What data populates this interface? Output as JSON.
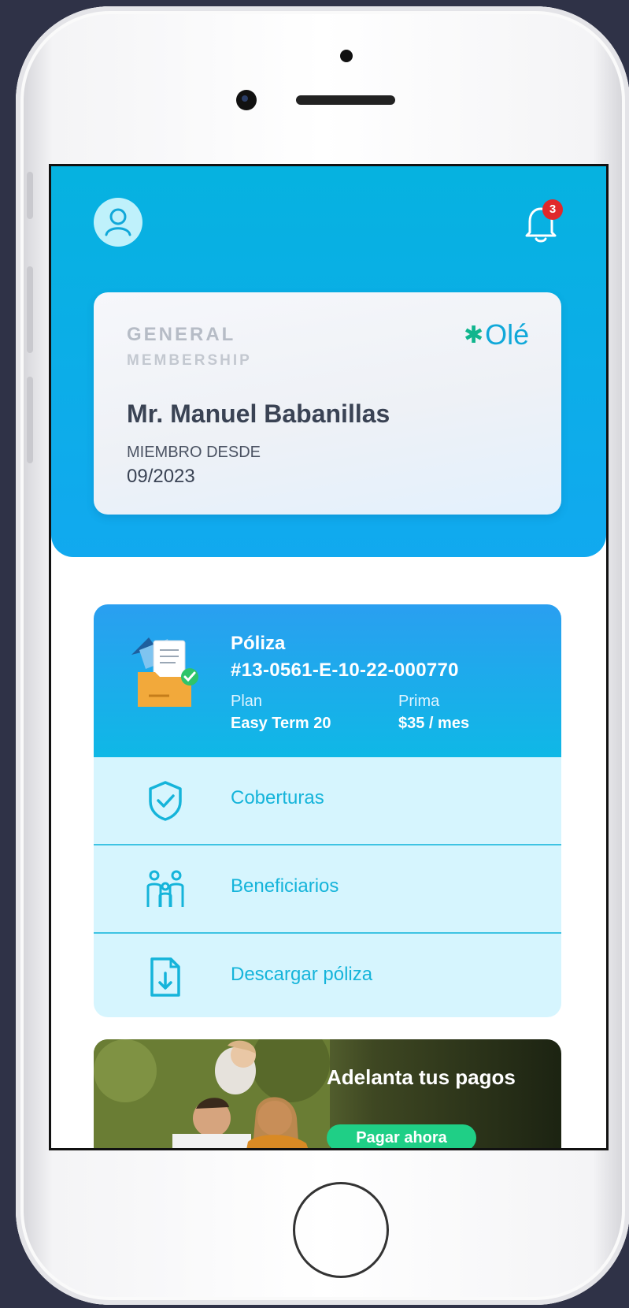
{
  "header": {
    "notification_count": "3"
  },
  "membership": {
    "title_line1": "GENERAL",
    "title_line2": "MEMBERSHIP",
    "brand": "Olé",
    "name": "Mr. Manuel Babanillas",
    "since_label": "MIEMBRO DESDE",
    "since_date": "09/2023"
  },
  "policy": {
    "label": "Póliza",
    "number": "#13-0561-E-10-22-000770",
    "plan_label": "Plan",
    "plan_value": "Easy Term 20",
    "prima_label": "Prima",
    "prima_value": "$35 / mes",
    "menu": [
      {
        "label": "Coberturas",
        "icon": "shield-check-icon"
      },
      {
        "label": "Beneficiarios",
        "icon": "family-icon"
      },
      {
        "label": "Descargar póliza",
        "icon": "download-document-icon"
      }
    ]
  },
  "promo": {
    "title": "Adelanta tus pagos",
    "button": "Pagar ahora"
  },
  "colors": {
    "header_blue": "#11a9ef",
    "accent_cyan": "#15b4da",
    "menu_bg": "#d6f5fe",
    "badge_red": "#e0282b",
    "button_green": "#1fcf86"
  }
}
